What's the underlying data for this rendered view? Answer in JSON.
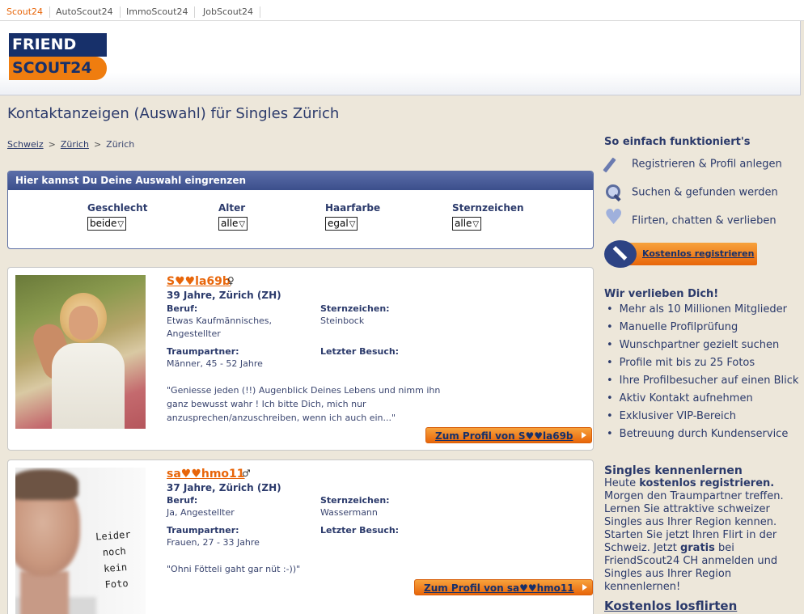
{
  "topnav": {
    "tabs": [
      "Scout24",
      "AutoScout24",
      "ImmoScout24",
      "JobScout24"
    ]
  },
  "logo": {
    "line1": "FRIEND",
    "line2": "SCOUT24"
  },
  "page_title": "Kontaktanzeigen (Auswahl) für Singles Zürich",
  "breadcrumb": {
    "items": [
      "Schweiz",
      "Zürich",
      "Zürich"
    ]
  },
  "filter": {
    "heading": "Hier kannst Du Deine Auswahl eingrenzen",
    "fields": [
      {
        "label": "Geschlecht",
        "value": "beide"
      },
      {
        "label": "Alter",
        "value": "alle"
      },
      {
        "label": "Haarfarbe",
        "value": "egal"
      },
      {
        "label": "Sternzeichen",
        "value": "alle"
      }
    ]
  },
  "labels": {
    "beruf": "Beruf:",
    "sternzeichen": "Sternzeichen:",
    "traumpartner": "Traumpartner:",
    "letzter_besuch": "Letzter Besuch:"
  },
  "profiles": [
    {
      "name": "S♥♥la69b",
      "gender_symbol": "♀",
      "age_city": "39 Jahre, Zürich (ZH)",
      "beruf": "Etwas Kaufmännisches, Angestellter",
      "sternzeichen": "Steinbock",
      "traumpartner": "Männer, 45 - 52 Jahre",
      "letzter_besuch": "",
      "quote": "\"Geniesse jeden (!!) Augenblick Deines Lebens und nimm ihn ganz bewusst wahr ! Ich bitte Dich, mich nur anzusprechen/anzuschreiben, wenn ich auch ein...\"",
      "button": "Zum Profil von S♥♥la69b"
    },
    {
      "name": "sa♥♥hmo11",
      "gender_symbol": "♂",
      "age_city": "37 Jahre, Zürich (ZH)",
      "beruf": "Ja, Angestellter",
      "sternzeichen": "Wassermann",
      "traumpartner": "Frauen, 27 - 33 Jahre",
      "letzter_besuch": "",
      "quote": "\"Ohni Fötteli gaht gar nüt :-))\"",
      "button": "Zum Profil von sa♥♥hmo11",
      "no_photo_text": [
        "Leider",
        "noch",
        "kein",
        "Foto"
      ]
    }
  ],
  "sidebar": {
    "how_title": "So einfach funktioniert's",
    "steps": [
      {
        "icon": "pen-icon",
        "label": "Registrieren & Profil anlegen"
      },
      {
        "icon": "magnifier-icon",
        "label": "Suchen & gefunden werden"
      },
      {
        "icon": "heart-icon",
        "label": "Flirten, chatten & verlieben"
      }
    ],
    "register_button": "Kostenlos registrieren",
    "love_title": "Wir verlieben Dich!",
    "benefits": [
      "Mehr als 10 Millionen Mitglieder",
      "Manuelle Profilprüfung",
      "Wunschpartner gezielt suchen",
      "Profile mit bis zu 25 Fotos",
      "Ihre Profilbesucher auf einen Blick",
      "Aktiv Kontakt aufnehmen",
      "Exklusiver VIP-Bereich",
      "Betreuung durch Kundenservice"
    ],
    "singles_title": "Singles kennenlernen",
    "singles_text_1": "Heute ",
    "singles_bold_1": "kostenlos registrieren.",
    "singles_text_2": " Morgen den Traumpartner treffen. Lernen Sie attraktive schweizer Singles aus Ihrer Region kennen. Starten Sie jetzt Ihren Flirt in der Schweiz. Jetzt ",
    "singles_bold_2": "gratis",
    "singles_text_3": " bei FriendScout24 CH anmelden und Singles aus Ihrer Region kennenlernen!",
    "flirt_link": "Kostenlos losflirten"
  }
}
